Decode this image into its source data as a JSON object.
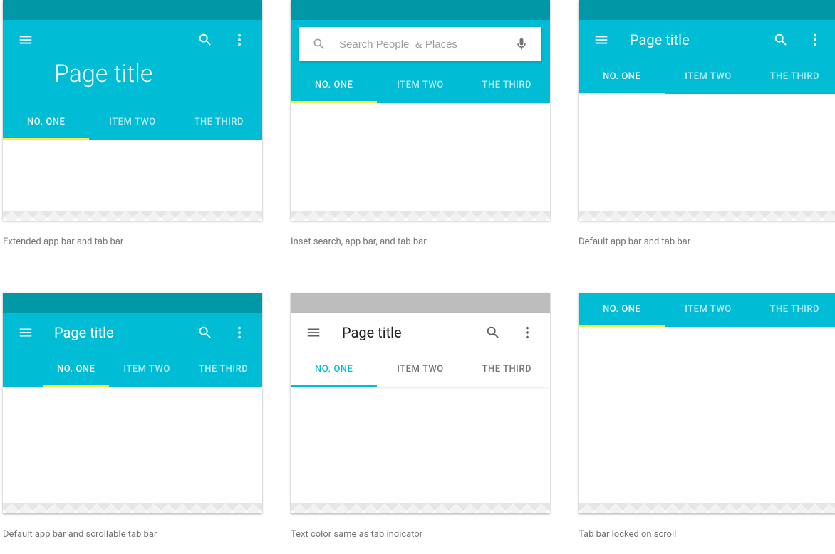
{
  "colors": {
    "primary": "#00BCD4",
    "primary_dark": "#0097A7",
    "accent": "#FFEB3B"
  },
  "panels": {
    "p1": {
      "title": "Page title",
      "tabs": [
        "NO. ONE",
        "ITEM TWO",
        "THE THIRD"
      ],
      "active_tab": 0,
      "caption": "Extended app bar and tab bar"
    },
    "p2": {
      "search_placeholder": "Search People  & Places",
      "tabs": [
        "NO. ONE",
        "ITEM TWO",
        "THE THIRD"
      ],
      "active_tab": 0,
      "caption": "Inset search, app bar, and tab bar"
    },
    "p3": {
      "title": "Page title",
      "tabs": [
        "NO. ONE",
        "ITEM TWO",
        "THE THIRD"
      ],
      "active_tab": 0,
      "caption": "Default app bar and tab bar"
    },
    "p4": {
      "title": "Page title",
      "tabs": [
        "NO. ONE",
        "ITEM TWO",
        "THE THIRD"
      ],
      "active_tab": 0,
      "caption": "Default app bar and scrollable tab bar"
    },
    "p5": {
      "title": "Page title",
      "tabs": [
        "NO. ONE",
        "ITEM TWO",
        "THE THIRD"
      ],
      "active_tab": 0,
      "caption": "Text color same as tab indicator"
    },
    "p6": {
      "tabs": [
        "NO. ONE",
        "ITEM TWO",
        "THE THIRD"
      ],
      "active_tab": 0,
      "caption": "Tab bar locked on scroll"
    }
  }
}
